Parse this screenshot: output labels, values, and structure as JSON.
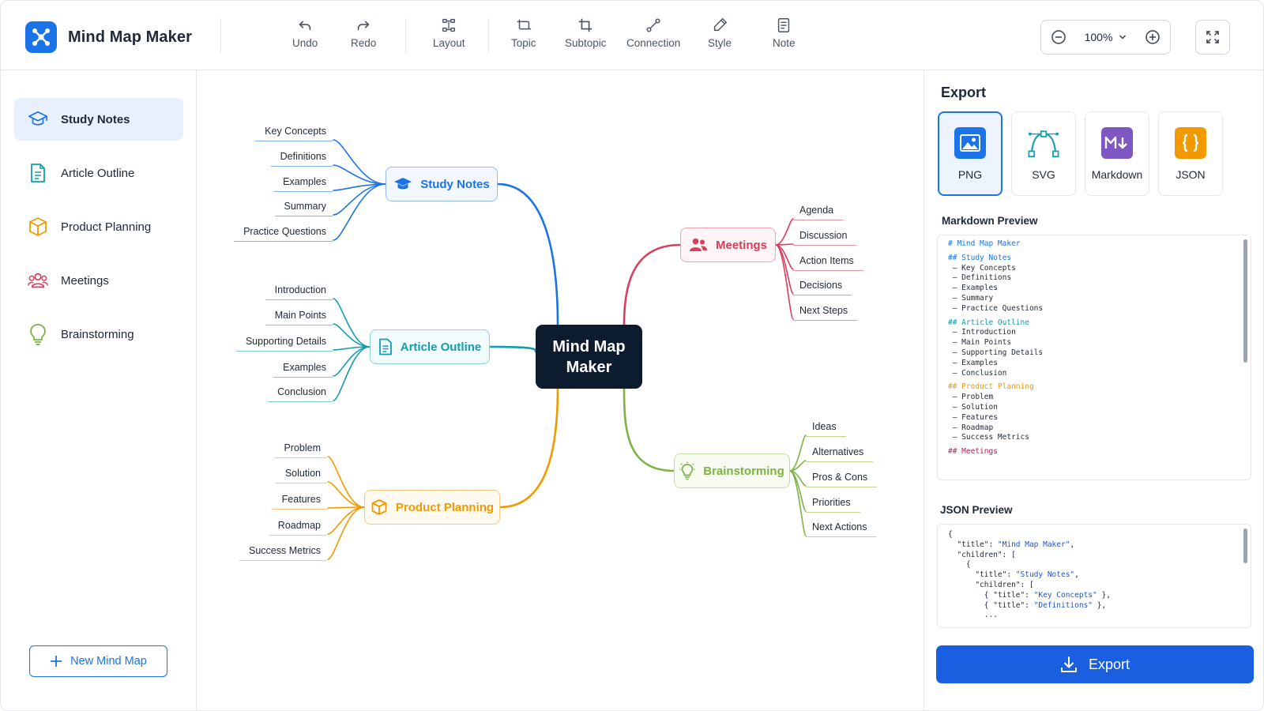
{
  "app": {
    "title": "Mind Map Maker"
  },
  "toolbar": {
    "undo": "Undo",
    "redo": "Redo",
    "layout": "Layout",
    "topic": "Topic",
    "subtopic": "Subtopic",
    "connection": "Connection",
    "style": "Style",
    "note": "Note",
    "zoom": "100%"
  },
  "sidebar": {
    "items": [
      {
        "label": "Study Notes",
        "icon": "graduation-cap-icon",
        "color": "#1a73e8",
        "active": true
      },
      {
        "label": "Article Outline",
        "icon": "document-icon",
        "color": "#129eaf"
      },
      {
        "label": "Product Planning",
        "icon": "cube-icon",
        "color": "#f29900"
      },
      {
        "label": "Meetings",
        "icon": "people-icon",
        "color": "#d93f5a"
      },
      {
        "label": "Brainstorming",
        "icon": "lightbulb-icon",
        "color": "#7cb342"
      }
    ],
    "new_map": "New Mind Map"
  },
  "map": {
    "center": {
      "line1": "Mind Map",
      "line2": "Maker"
    },
    "branches": [
      {
        "key": "study",
        "title": "Study Notes",
        "color": "#1a73e8",
        "children": [
          "Key Concepts",
          "Definitions",
          "Examples",
          "Summary",
          "Practice Questions"
        ]
      },
      {
        "key": "article",
        "title": "Article Outline",
        "color": "#129eaf",
        "children": [
          "Introduction",
          "Main Points",
          "Supporting Details",
          "Examples",
          "Conclusion"
        ]
      },
      {
        "key": "product",
        "title": "Product Planning",
        "color": "#f29900",
        "children": [
          "Problem",
          "Solution",
          "Features",
          "Roadmap",
          "Success Metrics"
        ]
      },
      {
        "key": "meetings",
        "title": "Meetings",
        "color": "#d93f5a",
        "children": [
          "Agenda",
          "Discussion",
          "Action Items",
          "Decisions",
          "Next Steps"
        ]
      },
      {
        "key": "brain",
        "title": "Brainstorming",
        "color": "#7cb342",
        "children": [
          "Ideas",
          "Alternatives",
          "Pros & Cons",
          "Priorities",
          "Next Actions"
        ]
      }
    ]
  },
  "export": {
    "title": "Export",
    "formats": [
      {
        "label": "PNG",
        "icon": "image-icon",
        "color": "#1a73e8",
        "selected": true
      },
      {
        "label": "SVG",
        "icon": "vector-pen-icon",
        "color": "#129eaf"
      },
      {
        "label": "Markdown",
        "icon": "markdown-icon",
        "color": "#7e57c2"
      },
      {
        "label": "JSON",
        "icon": "braces-icon",
        "color": "#f29900"
      }
    ],
    "markdown_title": "Markdown Preview",
    "markdown_lines": [
      {
        "t": "# Mind Map Maker",
        "c": "md-h"
      },
      {
        "t": "",
        "c": ""
      },
      {
        "t": "## Study Notes",
        "c": "md-h2-blue"
      },
      {
        "t": " – Key Concepts",
        "c": ""
      },
      {
        "t": " – Definitions",
        "c": ""
      },
      {
        "t": " – Examples",
        "c": ""
      },
      {
        "t": " – Summary",
        "c": ""
      },
      {
        "t": " – Practice Questions",
        "c": ""
      },
      {
        "t": "",
        "c": ""
      },
      {
        "t": "## Article Outline",
        "c": "md-h2-teal"
      },
      {
        "t": " – Introduction",
        "c": ""
      },
      {
        "t": " – Main Points",
        "c": ""
      },
      {
        "t": " – Supporting Details",
        "c": ""
      },
      {
        "t": " – Examples",
        "c": ""
      },
      {
        "t": " – Conclusion",
        "c": ""
      },
      {
        "t": "",
        "c": ""
      },
      {
        "t": "## Product Planning",
        "c": "md-h2-orange"
      },
      {
        "t": " – Problem",
        "c": ""
      },
      {
        "t": " – Solution",
        "c": ""
      },
      {
        "t": " – Features",
        "c": ""
      },
      {
        "t": " – Roadmap",
        "c": ""
      },
      {
        "t": " – Success Metrics",
        "c": ""
      },
      {
        "t": "",
        "c": ""
      },
      {
        "t": "## Meetings",
        "c": "md-h2-pink"
      }
    ],
    "json_title": "JSON Preview",
    "json_lines": [
      {
        "pre": "{",
        "str": "",
        "post": ""
      },
      {
        "pre": "  \"title\": ",
        "str": "\"Mind Map Maker\"",
        "post": ","
      },
      {
        "pre": "  \"children\": [",
        "str": "",
        "post": ""
      },
      {
        "pre": "    {",
        "str": "",
        "post": ""
      },
      {
        "pre": "      \"title\": ",
        "str": "\"Study Notes\"",
        "post": ","
      },
      {
        "pre": "      \"children\": [",
        "str": "",
        "post": ""
      },
      {
        "pre": "        { \"title\": ",
        "str": "\"Key Concepts\"",
        "post": " },"
      },
      {
        "pre": "        { \"title\": ",
        "str": "\"Definitions\"",
        "post": " },"
      },
      {
        "pre": "        ...",
        "str": "",
        "post": ""
      }
    ],
    "button": "Export"
  }
}
